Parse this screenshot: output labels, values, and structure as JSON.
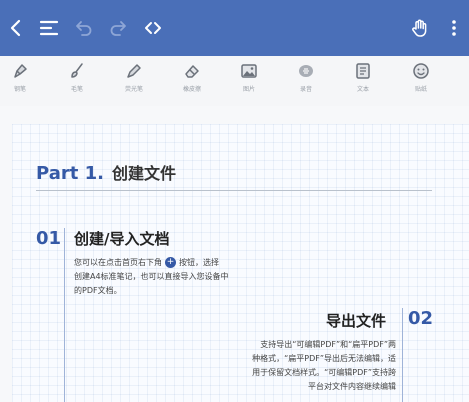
{
  "colors": {
    "appbar": "#4a6fb8",
    "accent": "#3559a6"
  },
  "topbar": {
    "icons": [
      "back-icon",
      "outline-icon",
      "undo-icon",
      "redo-icon",
      "code-icon",
      "hand-icon",
      "more-icon"
    ]
  },
  "toolbar": {
    "tools": [
      {
        "icon": "pen-icon",
        "label": "钢笔"
      },
      {
        "icon": "brush-icon",
        "label": "毛笔"
      },
      {
        "icon": "highlighter-icon",
        "label": "荧光笔"
      },
      {
        "icon": "eraser-icon",
        "label": "橡皮擦"
      },
      {
        "icon": "image-icon",
        "label": "图片"
      },
      {
        "icon": "audio-icon",
        "label": "录音"
      },
      {
        "icon": "text-icon",
        "label": "文本"
      },
      {
        "icon": "emoji-icon",
        "label": "贴纸"
      }
    ]
  },
  "document": {
    "part_label": "Part 1.",
    "part_title": "创建文件",
    "section1": {
      "number": "01",
      "title": "创建/导入文档",
      "line1_a": "您可以在点击首页右下角",
      "line1_b": "按钮，选择",
      "line2": "创建A4标准笔记，也可以直接导入您设备中",
      "line3": "的PDF文档。"
    },
    "section2": {
      "number": "02",
      "title": "导出文件",
      "line1": "支持导出“可编辑PDF”和“扁平PDF”两",
      "line2": "种格式，“扁平PDF”导出后无法编辑，适",
      "line3": "用于保留文档样式。“可编辑PDF”支持跨",
      "line4": "平台对文件内容继续编辑"
    }
  }
}
